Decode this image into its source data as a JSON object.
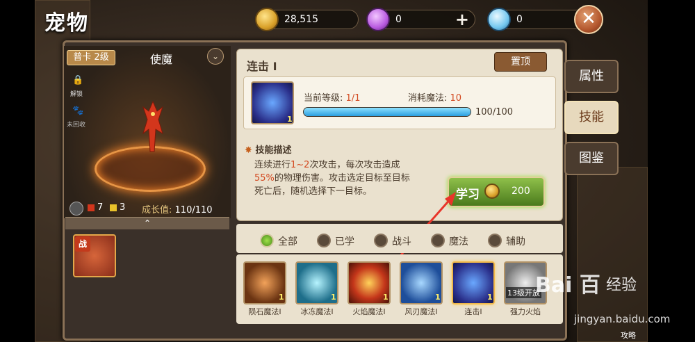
{
  "header": {
    "title": "宠物",
    "resources": [
      {
        "icon": "gold-coin-icon",
        "value": "28,515"
      },
      {
        "icon": "purple-gem-icon",
        "value": "0"
      },
      {
        "icon": "blue-diamond-icon",
        "value": "0"
      }
    ],
    "close_label": "✕"
  },
  "pet": {
    "rank_tag": "普卡 2级",
    "name": "使魔",
    "lock_label": "解锁",
    "hatch_label": "未回收",
    "red_count": "7",
    "yellow_count": "3",
    "growth_label": "成长值:",
    "growth_value": "110/110",
    "battle_tag": "战"
  },
  "skill": {
    "title": "连击 Ⅰ",
    "pin_label": "置顶",
    "level_badge": "1",
    "level_label": "当前等级:",
    "level_value": "1/1",
    "mana_label": "消耗魔法:",
    "mana_value": "10",
    "exp_value": "100/100",
    "exp_fraction": 1.0,
    "desc_title": "技能描述",
    "desc_1": "连续进行",
    "desc_hl_1": "1~2",
    "desc_2": "次攻击，每次攻击造成",
    "desc_hl_2": "55%",
    "desc_3": "的物理伤害。攻击选定目标至目标死亡后，随机选择下一目标。",
    "learn_label": "学习",
    "learn_cost": "200"
  },
  "filters": [
    {
      "label": "全部",
      "selected": true
    },
    {
      "label": "已学",
      "selected": false
    },
    {
      "label": "战斗",
      "selected": false
    },
    {
      "label": "魔法",
      "selected": false
    },
    {
      "label": "辅助",
      "selected": false
    }
  ],
  "skill_list": [
    {
      "name": "陨石魔法Ⅰ",
      "badge": "1",
      "icon": "meteor-skill-icon"
    },
    {
      "name": "冰冻魔法Ⅰ",
      "badge": "1",
      "icon": "ice-skill-icon"
    },
    {
      "name": "火焰魔法Ⅰ",
      "badge": "1",
      "icon": "fire-skill-icon"
    },
    {
      "name": "风刃魔法Ⅰ",
      "badge": "1",
      "icon": "wind-skill-icon"
    },
    {
      "name": "连击Ⅰ",
      "badge": "1",
      "icon": "combo-skill-icon"
    },
    {
      "name": "强力火焰",
      "badge": "",
      "icon": "strong-fire-skill-icon",
      "lock_text": "13级开放"
    }
  ],
  "side_tabs": [
    "属性",
    "技能",
    "图鉴"
  ],
  "watermark": {
    "logo": "Bai 百",
    "jingyan": "经验",
    "url": "jingyan.baidu.com"
  },
  "guide_label": "攻略",
  "colors": {
    "accent_red": "#d34a21",
    "learn_green": "#6aa82e",
    "panel_bg": "#eae1ce"
  }
}
